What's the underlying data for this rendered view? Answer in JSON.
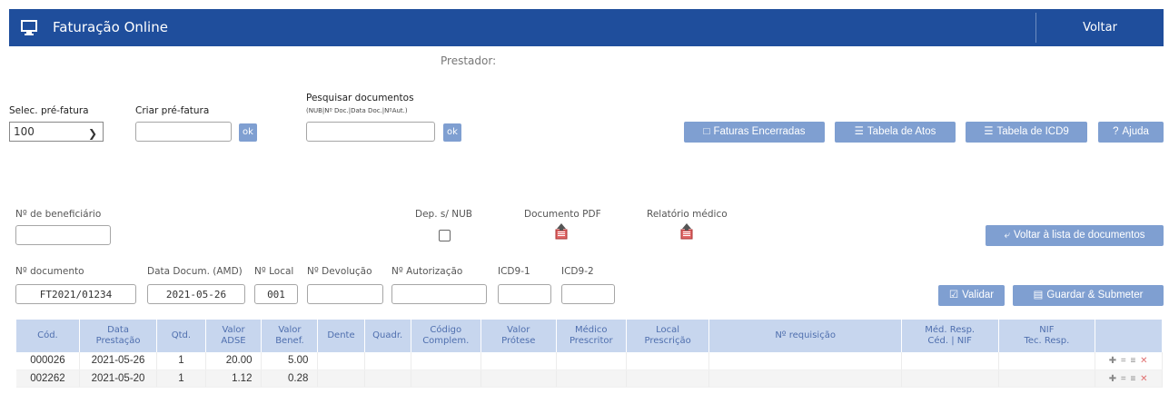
{
  "header": {
    "title": "Faturação Online",
    "back_label": "Voltar"
  },
  "prestador_label": "Prestador:",
  "prefatura": {
    "select_label": "Selec. pré-fatura",
    "select_value": "100",
    "create_label": "Criar pré-fatura",
    "ok_label": "ok"
  },
  "search": {
    "label": "Pesquisar documentos",
    "hint": "(NUB|Nº Doc.|Data Doc.|NºAut.)",
    "ok_label": "ok"
  },
  "toolbar": {
    "faturas_encerradas": "Faturas Encerradas",
    "tabela_atos": "Tabela de Atos",
    "tabela_icd9": "Tabela de ICD9",
    "ajuda": "Ajuda",
    "ajuda_icon": "?"
  },
  "form": {
    "beneficiario_label": "Nº de beneficiário",
    "dep_label": "Dep. s/ NUB",
    "pdf_label": "Documento PDF",
    "relatorio_label": "Relatório médico",
    "voltar_lista": "Voltar à lista de documentos",
    "doc_label": "Nº documento",
    "doc_value": "FT2021/01234",
    "data_label": "Data Docum. (AMD)",
    "data_value": "2021-05-26",
    "local_label": "Nº Local",
    "local_value": "001",
    "devolucao_label": "Nº Devolução",
    "autorizacao_label": "Nº Autorização",
    "icd1_label": "ICD9-1",
    "icd2_label": "ICD9-2",
    "validar": "Validar",
    "guardar": "Guardar & Submeter"
  },
  "table": {
    "headers": [
      [
        "Cód.",
        ""
      ],
      [
        "Data",
        "Prestação"
      ],
      [
        "Qtd.",
        ""
      ],
      [
        "Valor",
        "ADSE"
      ],
      [
        "Valor",
        "Benef."
      ],
      [
        "Dente",
        ""
      ],
      [
        "Quadr.",
        ""
      ],
      [
        "Código",
        "Complem."
      ],
      [
        "Valor",
        "Prótese"
      ],
      [
        "Médico",
        "Prescritor"
      ],
      [
        "Local",
        "Prescrição"
      ],
      [
        "Nº requisição",
        ""
      ],
      [
        "Méd. Resp.",
        "Céd. | NIF"
      ],
      [
        "NIF",
        "Tec. Resp."
      ],
      [
        "",
        ""
      ]
    ],
    "rows": [
      {
        "cod": "000026",
        "data": "2021-05-26",
        "qtd": "1",
        "adse": "20.00",
        "benef": "5.00"
      },
      {
        "cod": "002262",
        "data": "2021-05-20",
        "qtd": "1",
        "adse": "1.12",
        "benef": "0.28"
      }
    ]
  },
  "colors": {
    "header_bg": "#1f4e9c",
    "button_bg": "#7f9fd1",
    "table_header_bg": "#c7d6ee"
  },
  "icons": [
    "monitor-icon",
    "chevron-down-icon",
    "pdf-upload-icon",
    "list-icon",
    "undo-icon",
    "check-icon",
    "save-icon",
    "plus-icon",
    "delete-icon"
  ]
}
